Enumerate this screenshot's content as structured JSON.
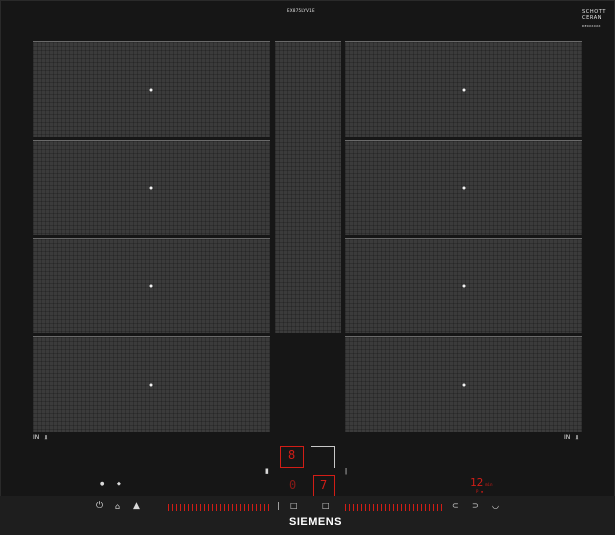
{
  "model_label": "EX875LYV1E",
  "brand": "SIEMENS",
  "schott_brand": [
    "SCHOTT",
    "CERAN"
  ],
  "schott_sub": "DE0XXXXX",
  "left_zone_label": "IN",
  "right_zone_label": "IN",
  "zone_icon": "induction-zone-icon",
  "controls": {
    "power_icon": "power-icon",
    "center_top_digit": "8",
    "center_top_sub": "",
    "center_bottom_digit": "0",
    "right_center_digit": "7",
    "timer_value": "12",
    "timer_unit": "min",
    "timer_sub": "P ▪"
  },
  "colors": {
    "glass": "#161616",
    "zone": "#3b3b3b",
    "control_red": "#d21d16",
    "print_white": "#e7e7e7"
  }
}
